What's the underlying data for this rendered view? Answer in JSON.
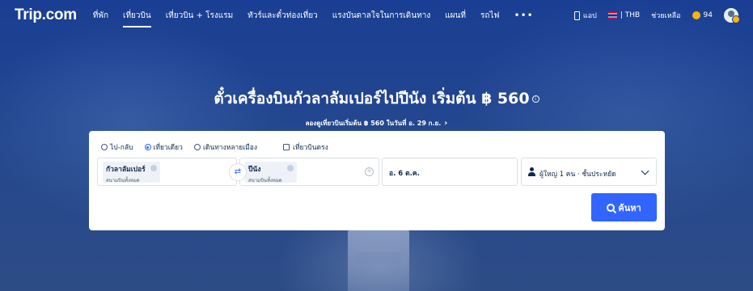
{
  "header": {
    "logo": "Trip.com",
    "nav": [
      {
        "label": "ที่พัก",
        "active": false
      },
      {
        "label": "เที่ยวบิน",
        "active": true
      },
      {
        "label": "เที่ยวบิน + โรงแรม",
        "active": false
      },
      {
        "label": "ทัวร์และตั๋วท่องเที่ยว",
        "active": false
      },
      {
        "label": "แรงบันดาลใจในการเดินทาง",
        "active": false
      },
      {
        "label": "แผนที่",
        "active": false
      },
      {
        "label": "รถไฟ",
        "active": false
      }
    ],
    "more": "•••",
    "app_label": "แอป",
    "currency_label": "| THB",
    "help_label": "ช่วยเหลือ",
    "points": "94"
  },
  "hero": {
    "title": "ตั๋วเครื่องบินกัวลาลัมเปอร์ไปปีนัง เริ่มต้น ฿ 560",
    "info": "i",
    "subtitle": "ลองดูเที่ยวบินเริ่มต้น ฿ 560 ในวันที่ อ. 29 ก.ย.",
    "chevron": "›"
  },
  "search": {
    "trip_types": [
      {
        "label": "ไป-กลับ",
        "checked": false
      },
      {
        "label": "เที่ยวเดียว",
        "checked": true
      },
      {
        "label": "เดินทางหลายเมือง",
        "checked": false
      }
    ],
    "direct_label": "เที่ยวบินตรง",
    "origin": {
      "name": "กัวลาลัมเปอร์",
      "sub": "สนามบินทั้งหมด"
    },
    "destination": {
      "name": "ปีนัง",
      "sub": "สนามบินทั้งหมด"
    },
    "swap": "⇄",
    "plus": "+",
    "date": "อ. 6 ต.ค.",
    "passengers": "ผู้ใหญ่ 1 คน · ชั้นประหยัด",
    "search_button": "ค้นหา"
  },
  "colors": {
    "accent": "#3264ff",
    "text_dark": "#0f294d",
    "hero_bg": "#1d3f8a"
  }
}
